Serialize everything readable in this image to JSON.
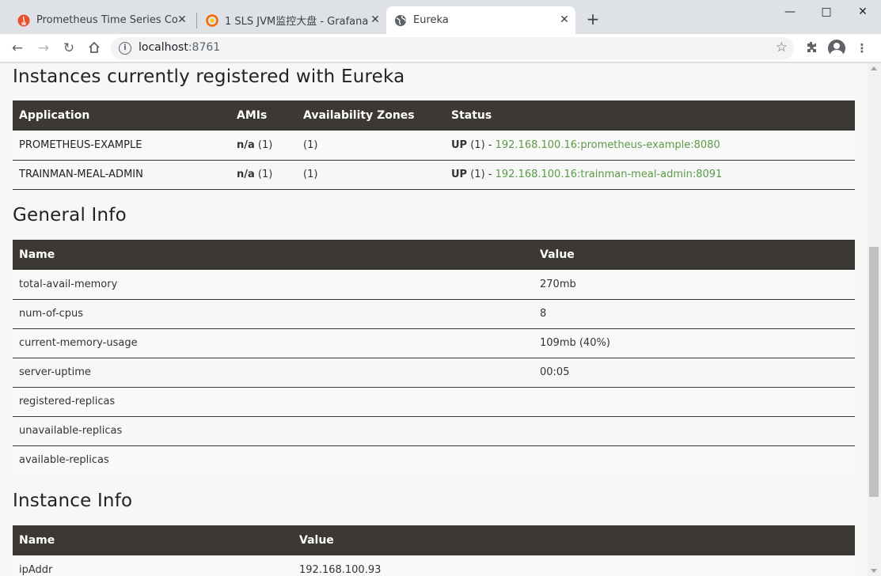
{
  "browser": {
    "tabs": [
      {
        "title": "Prometheus Time Series Collec",
        "icon": "prometheus-icon",
        "active": false
      },
      {
        "title": "1 SLS JVM监控大盘 - Grafana",
        "icon": "grafana-icon",
        "active": false
      },
      {
        "title": "Eureka",
        "icon": "globe-icon",
        "active": true
      }
    ],
    "new_tab_label": "+",
    "url_host": "localhost",
    "url_port": ":8761"
  },
  "instances": {
    "heading": "Instances currently registered with Eureka",
    "columns": [
      "Application",
      "AMIs",
      "Availability Zones",
      "Status"
    ],
    "rows": [
      {
        "application": "PROMETHEUS-EXAMPLE",
        "amis_bold": "n/a",
        "amis_count": " (1)",
        "zones": "(1)",
        "status_bold": "UP",
        "status_count": " (1) - ",
        "link": "192.168.100.16:prometheus-example:8080"
      },
      {
        "application": "TRAINMAN-MEAL-ADMIN",
        "amis_bold": "n/a",
        "amis_count": " (1)",
        "zones": "(1)",
        "status_bold": "UP",
        "status_count": " (1) - ",
        "link": "192.168.100.16:trainman-meal-admin:8091"
      }
    ]
  },
  "general_info": {
    "heading": "General Info",
    "columns": [
      "Name",
      "Value"
    ],
    "rows": [
      {
        "name": "total-avail-memory",
        "value": "270mb"
      },
      {
        "name": "num-of-cpus",
        "value": "8"
      },
      {
        "name": "current-memory-usage",
        "value": "109mb (40%)"
      },
      {
        "name": "server-uptime",
        "value": "00:05"
      },
      {
        "name": "registered-replicas",
        "value": ""
      },
      {
        "name": "unavailable-replicas",
        "value": ""
      },
      {
        "name": "available-replicas",
        "value": ""
      }
    ]
  },
  "instance_info": {
    "heading": "Instance Info",
    "columns": [
      "Name",
      "Value"
    ],
    "rows": [
      {
        "name": "ipAddr",
        "value": "192.168.100.93"
      }
    ]
  },
  "colors": {
    "table_header": "#3c3834",
    "link": "#5a9b47",
    "page_bg": "#f7f7f7"
  }
}
